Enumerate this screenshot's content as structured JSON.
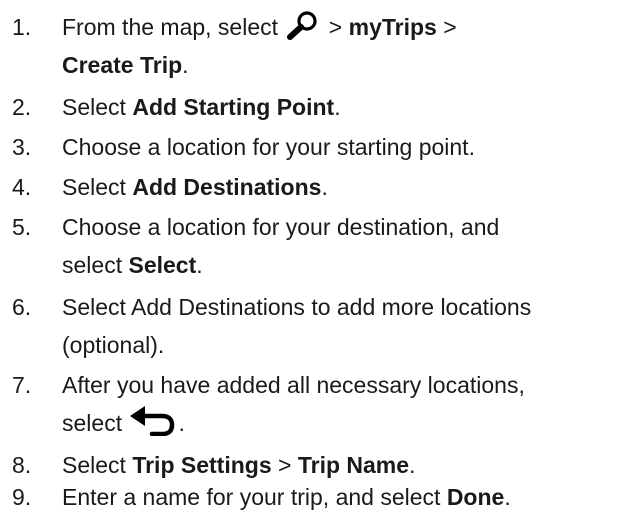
{
  "steps": [
    {
      "number": "1.",
      "parts": {
        "a": "From the map, select ",
        "icon": "search-icon",
        "b": " > ",
        "c": "myTrips",
        "d": " >",
        "e": "Create Trip",
        "f": "."
      }
    },
    {
      "number": "2.",
      "parts": {
        "a": "Select ",
        "b": "Add Starting Point",
        "c": "."
      }
    },
    {
      "number": "3.",
      "parts": {
        "a": "Choose a location for your starting point."
      }
    },
    {
      "number": "4.",
      "parts": {
        "a": "Select ",
        "b": "Add Destinations",
        "c": "."
      }
    },
    {
      "number": "5.",
      "parts": {
        "a": "Choose a location for your destination, and",
        "b": "select ",
        "c": "Select",
        "d": "."
      }
    },
    {
      "number": "6.",
      "parts": {
        "a": "Select Add Destinations to add more locations",
        "b": "(optional)."
      }
    },
    {
      "number": "7.",
      "parts": {
        "a": "After you have added all necessary locations,",
        "b": "select ",
        "icon": "back-arrow-icon",
        "c": "."
      }
    },
    {
      "number": "8.",
      "parts": {
        "a": "Select ",
        "b": "Trip Settings",
        "c": " > ",
        "d": "Trip Name",
        "e": "."
      }
    },
    {
      "number": "9.",
      "parts": {
        "a": "Enter a name for your trip, and select ",
        "b": "Done",
        "c": "."
      }
    }
  ]
}
